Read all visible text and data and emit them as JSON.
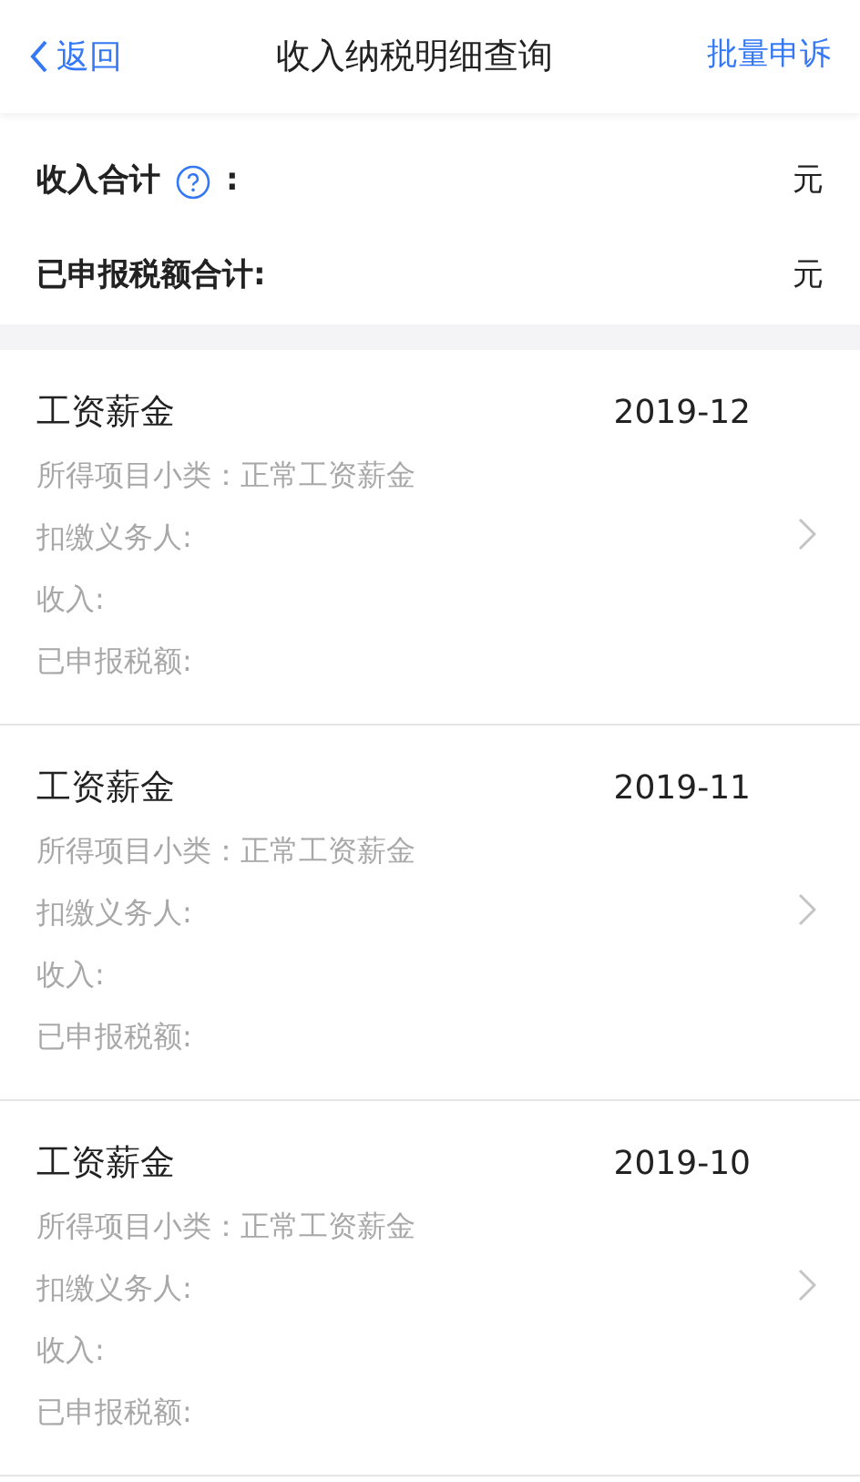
{
  "nav": {
    "back": "返回",
    "title": "收入纳税明细查询",
    "action": "批量申诉"
  },
  "summary": [
    {
      "kind": "help",
      "label": "收入合计",
      "colon": ":",
      "unit": "元"
    },
    {
      "kind": "plain",
      "label": "已申报税额合计:",
      "unit": "元"
    }
  ],
  "records": [
    {
      "title": "工资薪金",
      "date": "2019-12",
      "fields": [
        "所得项目小类：正常工资薪金",
        "扣缴义务人:",
        "收入:",
        "已申报税额:"
      ]
    },
    {
      "title": "工资薪金",
      "date": "2019-11",
      "fields": [
        "所得项目小类：正常工资薪金",
        "扣缴义务人:",
        "收入:",
        "已申报税额:"
      ]
    },
    {
      "title": "工资薪金",
      "date": "2019-10",
      "fields": [
        "所得项目小类：正常工资薪金",
        "扣缴义务人:",
        "收入:",
        "已申报税额:"
      ]
    }
  ]
}
